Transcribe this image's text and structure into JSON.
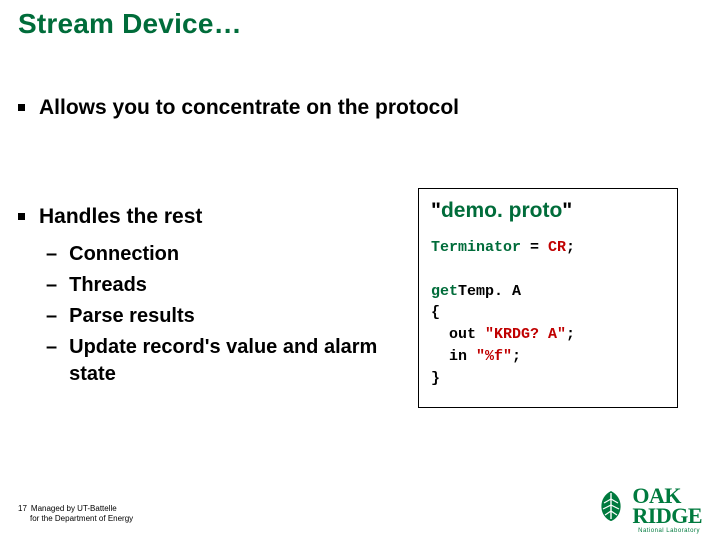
{
  "title": "Stream Device…",
  "bullets": {
    "b1": "Allows you to concentrate on the protocol",
    "b2": "Handles the rest",
    "sub": {
      "s1": "Connection",
      "s2": "Threads",
      "s3": "Parse results",
      "s4": "Update record's value and alarm state"
    }
  },
  "codebox": {
    "title_prefix": "\"",
    "title_green": "demo. proto",
    "title_suffix": "\"",
    "line1a": "Terminator",
    "line1b": " = ",
    "line1c": "CR",
    "line1d": ";",
    "line2a": "get",
    "line2b": "Temp. A",
    "line3": "{",
    "line4a": "  out ",
    "line4b": "\"KRDG? A\"",
    "line4c": ";",
    "line5a": "  in ",
    "line5b": "\"%f\"",
    "line5c": ";",
    "line6": "}"
  },
  "footer": {
    "pagenum": "17",
    "line1": "Managed by UT-Battelle",
    "line2": "for the Department of Energy"
  },
  "logo": {
    "text": "OAK",
    "text2": "RIDGE",
    "sub": "National Laboratory"
  }
}
